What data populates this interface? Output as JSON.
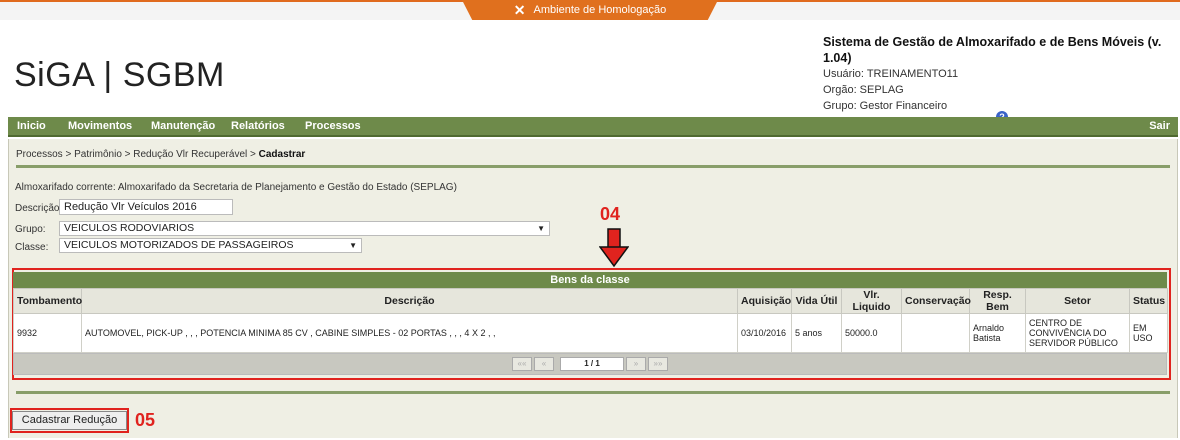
{
  "env": {
    "label": "Ambiente de Homologação"
  },
  "logo": {
    "text": "SiGA | SGBM"
  },
  "sys": {
    "title": "Sistema de Gestão de Almoxarifado e de Bens Móveis (v. 1.04)",
    "user": "Usuário: TREINAMENTO11",
    "org": "Orgão: SEPLAG",
    "group": "Grupo: Gestor Financeiro"
  },
  "nav": {
    "items": [
      "Inicio",
      "Movimentos",
      "Manutenção",
      "Relatórios",
      "Processos"
    ],
    "logout": "Sair"
  },
  "breadcrumb": {
    "path": "Processos  > Patrimônio  > Redução Vlr Recuperável  > ",
    "current": "Cadastrar"
  },
  "form": {
    "almox": "Almoxarifado corrente: Almoxarifado da Secretaria de Planejamento e Gestão do Estado (SEPLAG)",
    "desc_label": "Descrição:",
    "desc_value": "Redução Vlr Veículos 2016",
    "grupo_label": "Grupo:",
    "grupo_value": "VEICULOS RODOVIARIOS",
    "classe_label": "Classe:",
    "classe_value": "VEICULOS MOTORIZADOS DE PASSAGEIROS"
  },
  "annotations": {
    "a04": "04",
    "a05": "05"
  },
  "table": {
    "title": "Bens da classe",
    "headers": [
      "Tombamento",
      "Descrição",
      "Aquisição",
      "Vida Útil",
      "Vlr. Liquido",
      "Conservação",
      "Resp. Bem",
      "Setor",
      "Status"
    ],
    "rows": [
      [
        "9932",
        "AUTOMOVEL, PICK-UP , , , POTENCIA MINIMA 85 CV , CABINE SIMPLES - 02 PORTAS , , , 4 X 2 , ,",
        "03/10/2016",
        "5 anos",
        "50000.0",
        "",
        "Arnaldo Batista",
        "CENTRO DE CONVIVÊNCIA DO SERVIDOR PÚBLICO",
        "EM USO"
      ]
    ],
    "pager": {
      "first": "«« ",
      "prev": "«",
      "page": "1 / 1",
      "next": "»",
      "last": "»»"
    }
  },
  "buttons": {
    "submit": "Cadastrar Redução"
  },
  "colors": {
    "accent": "#6e8a4a",
    "env": "#e0701e",
    "annotation": "#e0231e"
  }
}
